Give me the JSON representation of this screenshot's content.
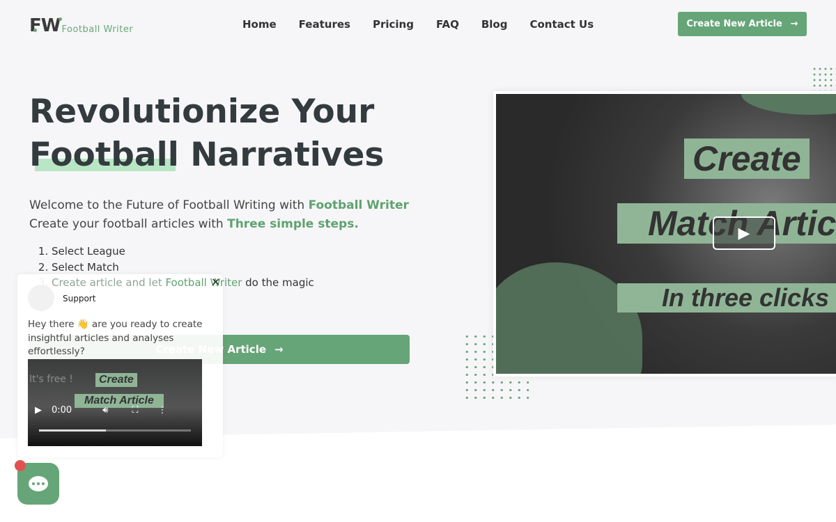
{
  "brand": {
    "mark": "FW",
    "name": "Football Writer"
  },
  "nav": [
    "Home",
    "Features",
    "Pricing",
    "FAQ",
    "Blog",
    "Contact Us"
  ],
  "header_cta": "Create New Article",
  "hero": {
    "title_line1": "Revolutionize Your",
    "title_word_highlight": "Football",
    "title_rest": " Narratives",
    "intro1": "Welcome to the Future of Football Writing with ",
    "intro1_em": "Football Writer",
    "intro2": "Create your football articles with ",
    "intro2_em": "Three simple steps.",
    "steps": [
      "Select League",
      "Select Match"
    ],
    "step3_a": "Create article and let ",
    "step3_em": "Football Writer",
    "step3_b": " do the magic",
    "cta": "Create New Article",
    "free": "It's free !"
  },
  "video": {
    "labels": [
      "Create",
      "Match Article",
      "In three clicks !"
    ]
  },
  "chat": {
    "name": "Support",
    "message": "Hey there 👋 are you ready to create insightful articles and analyses effortlessly?",
    "time": "0:00",
    "progress": 0.44,
    "close": "×"
  },
  "colors": {
    "accent": "#66a577",
    "highlight": "#b9e6c4",
    "notification": "#e05252"
  }
}
